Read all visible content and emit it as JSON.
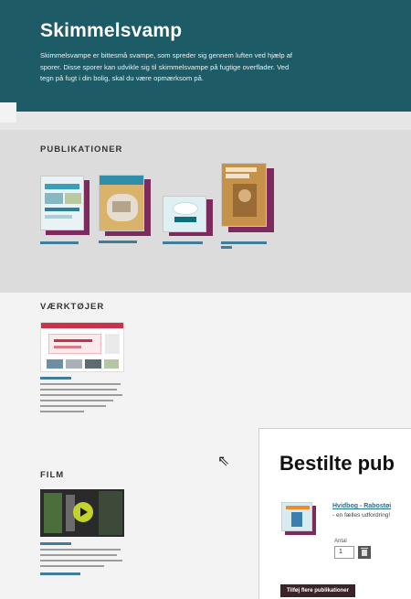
{
  "hero": {
    "title": "Skimmelsvamp",
    "description": "Skimmelsvampe er bittesmå svampe, som spreder sig gennem luften ved hjælp af sporer. Disse sporer kan udvikle sig til skimmelsvampe på fugtige overflader. Ved tegn på fugt i din bolig, skal du være opmærksom på."
  },
  "sections": {
    "publications": {
      "title": "PUBLIKATIONER"
    },
    "tools": {
      "title": "VÆRKTØJER"
    },
    "film": {
      "title": "FILM"
    }
  },
  "order_panel": {
    "title": "Bestilte pub",
    "item": {
      "title": "Hvidbog - Rabostøi",
      "subtitle": "- en fælles udfordring!"
    },
    "quantity_label": "Antal",
    "quantity_value": "1",
    "add_more_label": "Tilføj flere publikationer"
  },
  "colors": {
    "hero_bg": "#1d5b66",
    "accent": "#7d2a5f",
    "link": "#3f7d9a",
    "button_dark": "#3a2429",
    "play": "#c2d32c"
  }
}
